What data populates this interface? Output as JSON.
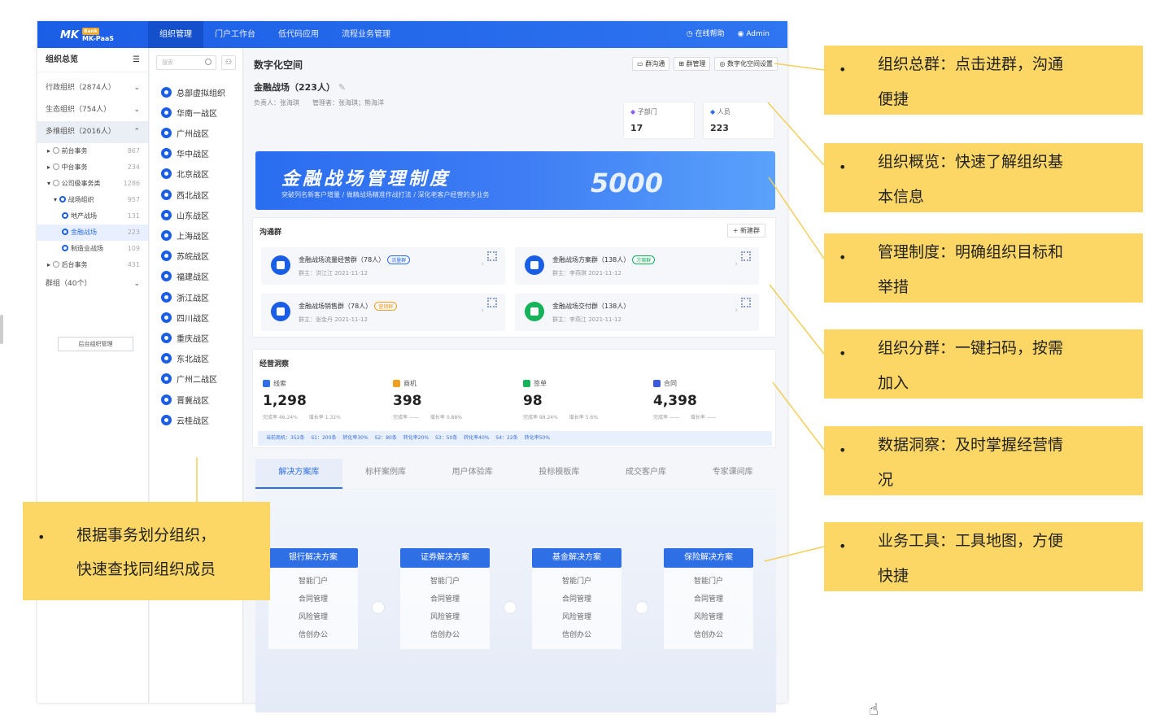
{
  "topbar": {
    "logo": "MK-PaaS",
    "logo_badge": "Bank",
    "nav": [
      "组织管理",
      "门户工作台",
      "低代码应用",
      "流程业务管理"
    ],
    "help": "在线帮助",
    "user": "Admin"
  },
  "left_panel": {
    "title": "组织总览",
    "orgs": [
      {
        "label": "行政组织（2874人）"
      },
      {
        "label": "生态组织（754人）"
      },
      {
        "label": "多维组织（2016人）"
      }
    ],
    "subs": [
      {
        "label": "前台事务",
        "count": "867"
      },
      {
        "label": "中台事务",
        "count": "234"
      },
      {
        "label": "公司级事务类",
        "count": "1286"
      },
      {
        "label": "战场组织",
        "count": "957"
      },
      {
        "label": "地产战场",
        "count": "131"
      },
      {
        "label": "金融战场",
        "count": "223"
      },
      {
        "label": "制造业战场",
        "count": "109"
      },
      {
        "label": "后台事务",
        "count": "431"
      }
    ],
    "group": "群组（40个）",
    "manage_btn": "后台组织管理"
  },
  "mid_panel": {
    "search_placeholder": "搜索",
    "zones": [
      "总部虚拟组织",
      "华南一战区",
      "广州战区",
      "华中战区",
      "北京战区",
      "西北战区",
      "山东战区",
      "上海战区",
      "苏皖战区",
      "福建战区",
      "浙江战区",
      "四川战区",
      "重庆战区",
      "东北战区",
      "广州二战区",
      "晋冀战区",
      "云桂战区"
    ]
  },
  "main": {
    "title": "数字化空间",
    "buttons": [
      "群沟通",
      "群管理",
      "数字化空间设置"
    ],
    "space_name": "金融战场（223人）",
    "owner": "负责人：张海琪",
    "admins": "管理者：张海琪；熊海洋",
    "stats": [
      {
        "label": "子部门",
        "value": "17"
      },
      {
        "label": "人员",
        "value": "223"
      }
    ],
    "banner": {
      "title": "金融战场管理制度",
      "subtitle": "突破列名新客户增量  /  做精战场精准作战打法  /  深化老客户经营的多业务",
      "number": "5000"
    },
    "groups_title": "沟通群",
    "new_group": "+ 新建群",
    "groups": [
      {
        "name": "金融战场流量经营群（78人）",
        "tag": "流量群",
        "tag_color": "#2f6fe5",
        "sub": "群主：洪江江    2021-11-12",
        "icon": "blue"
      },
      {
        "name": "金融战场方案群（138人）",
        "tag": "方案群",
        "tag_color": "#16b35a",
        "sub": "群主：李燕琪    2021-11-12",
        "icon": "blue"
      },
      {
        "name": "金融战场销售群（78人）",
        "tag": "营销群",
        "tag_color": "#f0a020",
        "sub": "群主：张金丹    2021-11-12",
        "icon": "blue"
      },
      {
        "name": "金融战场交付群（138人）",
        "tag": "",
        "tag_color": "",
        "sub": "群主：李燕江    2021-11-12",
        "icon": "green"
      }
    ],
    "insight_title": "经营洞察",
    "metrics": [
      {
        "label": "线索",
        "value": "1,298",
        "r1": "完成率 46.24%",
        "r2": "增长率 1.32%",
        "color": "#2f6fe5"
      },
      {
        "label": "商机",
        "value": "398",
        "r1": "完成率 ——",
        "r2": "增长率 0.88%",
        "color": "#f0a020"
      },
      {
        "label": "签单",
        "value": "98",
        "r1": "完成率 98.24%",
        "r2": "增长率 5.6%",
        "color": "#16b35a"
      },
      {
        "label": "合同",
        "value": "4,398",
        "r1": "完成率 ——",
        "r2": "增长率 ——",
        "color": "#3b5bdb"
      }
    ],
    "insight_bar": "当前商机：352条   S1：200条   转化率30%   S2：80条   转化率20%   S3：50条   转化率40%   S4：22条   转化率50%",
    "tabs": [
      "解决方案库",
      "标杆案例库",
      "用户体验库",
      "投标模板库",
      "成交客户库",
      "专家课间库"
    ],
    "solutions": [
      {
        "title": "银行解决方案",
        "items": [
          "智能门户",
          "合同管理",
          "风险管理",
          "信创办公"
        ]
      },
      {
        "title": "证券解决方案",
        "items": [
          "智能门户",
          "合同管理",
          "风险管理",
          "信创办公"
        ]
      },
      {
        "title": "基金解决方案",
        "items": [
          "智能门户",
          "合同管理",
          "风险管理",
          "信创办公"
        ]
      },
      {
        "title": "保险解决方案",
        "items": [
          "智能门户",
          "合同管理",
          "风险管理",
          "信创办公"
        ]
      }
    ]
  },
  "annotations": {
    "bullet": "•",
    "right": [
      {
        "l1": "组织总群：点击进群，沟通",
        "l2": "便捷"
      },
      {
        "l1": "组织概览：快速了解组织基",
        "l2": "本信息"
      },
      {
        "l1": "管理制度：明确组织目标和",
        "l2": "举措"
      },
      {
        "l1": "组织分群：一键扫码，按需",
        "l2": "加入"
      },
      {
        "l1": "数据洞察：及时掌握经营情",
        "l2": "况"
      },
      {
        "l1": "业务工具：工具地图，方便",
        "l2": "快捷"
      }
    ],
    "left": {
      "l1": "根据事务划分组织，",
      "l2": "快速查找同组织成员"
    }
  },
  "colors": {
    "primary": "#1b5ee6",
    "annotation": "#fdd765"
  }
}
